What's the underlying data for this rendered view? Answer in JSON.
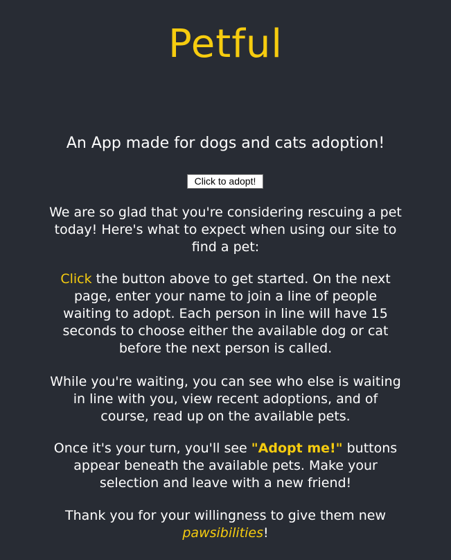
{
  "header": {
    "title": "Petful",
    "subtitle": "An App made for dogs and cats adoption!"
  },
  "actions": {
    "adopt_button_label": "Click to adopt!"
  },
  "intro": {
    "p1": "We are so glad that you're considering rescuing a pet today! Here's what to expect when using our site to find a pet:",
    "p2_highlight": "Click",
    "p2_rest": " the button above to get started. On the next page, enter your name to join a line of people waiting to adopt. Each person in line will have 15 seconds to choose either the available dog or cat before the next person is called.",
    "p3": "While you're waiting, you can see who else is waiting in line with you, view recent adoptions, and of course, read up on the available pets.",
    "p4_before": "Once it's your turn, you'll see ",
    "p4_highlight": "\"Adopt me!\"",
    "p4_after": " buttons appear beneath the available pets. Make your selection and leave with a new friend!",
    "p5_before": "Thank you for your willingness to give them new ",
    "p5_highlight": "pawsibilities",
    "p5_after": "!"
  },
  "colors": {
    "background": "#282c34",
    "accent": "#f6cc0f",
    "text": "#ffffff"
  }
}
